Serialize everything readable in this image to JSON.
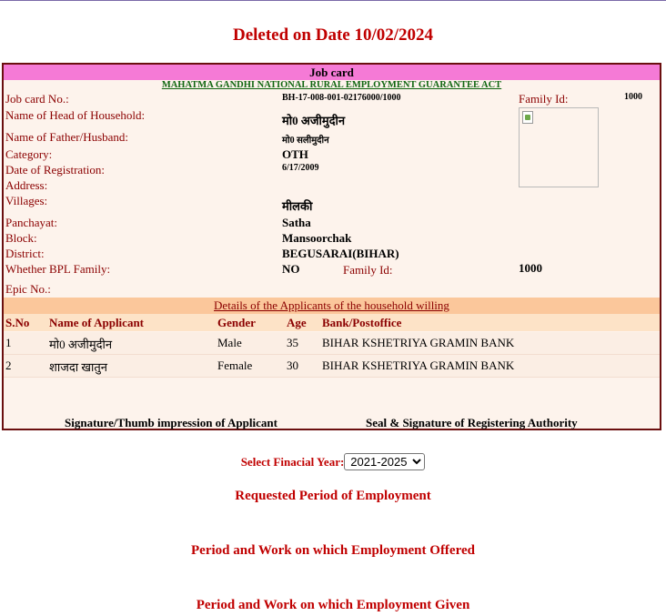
{
  "header": {
    "deleted_text": "Deleted on Date 10/02/2024"
  },
  "jobcard": {
    "title": "Job card",
    "act": "MAHATMA GANDHI NATIONAL RURAL EMPLOYMENT GUARANTEE ACT",
    "labels": {
      "jobcard_no": "Job card No.:",
      "head": "Name of Head of Household:",
      "father": "Name of Father/Husband:",
      "category": "Category:",
      "registration": "Date of Registration:",
      "address": "Address:",
      "villages": "Villages:",
      "panchayat": "Panchayat:",
      "block": "Block:",
      "district": "District:",
      "bpl": "Whether BPL Family:",
      "epic": "Epic No.:",
      "family_id": "Family Id:"
    },
    "values": {
      "jobcard_no": "BH-17-008-001-02176000/1000",
      "head": "मो0 अजीमुदीन",
      "father": "मो0 सलीमुदीन",
      "category": "OTH",
      "registration": "6/17/2009",
      "address": "",
      "villages": "मीलकी",
      "panchayat": "Satha",
      "block": "Mansoorchak",
      "district": "BEGUSARAI(BIHAR)",
      "bpl": "NO",
      "epic": "",
      "family_id": "1000",
      "family_id_2": "1000"
    },
    "details_title": "Details of the Applicants of the household willing",
    "applicants_columns": [
      "S.No",
      "Name of Applicant",
      "Gender",
      "Age",
      "Bank/Postoffice"
    ],
    "applicants": [
      {
        "sno": "1",
        "name": "मो0 अजीमुदीन",
        "gender": "Male",
        "age": "35",
        "bank": "BIHAR KSHETRIYA GRAMIN BANK"
      },
      {
        "sno": "2",
        "name": "शाजदा खातुन",
        "gender": "Female",
        "age": "30",
        "bank": "BIHAR KSHETRIYA GRAMIN BANK"
      }
    ],
    "sig_applicant": "Signature/Thumb impression of Applicant",
    "sig_authority": "Seal & Signature of Registering Authority"
  },
  "financial_year": {
    "label": "Select Finacial Year:",
    "selected": "2021-2025"
  },
  "sections": {
    "requested": "Requested Period of Employment",
    "offered": "Period and Work on which Employment Offered",
    "given": "Period and Work on which Employment Given"
  },
  "colors": {
    "title_red": "#c00000",
    "label_maroon": "#8b0000",
    "header_pink": "#f57ad6",
    "act_green": "#116611"
  }
}
